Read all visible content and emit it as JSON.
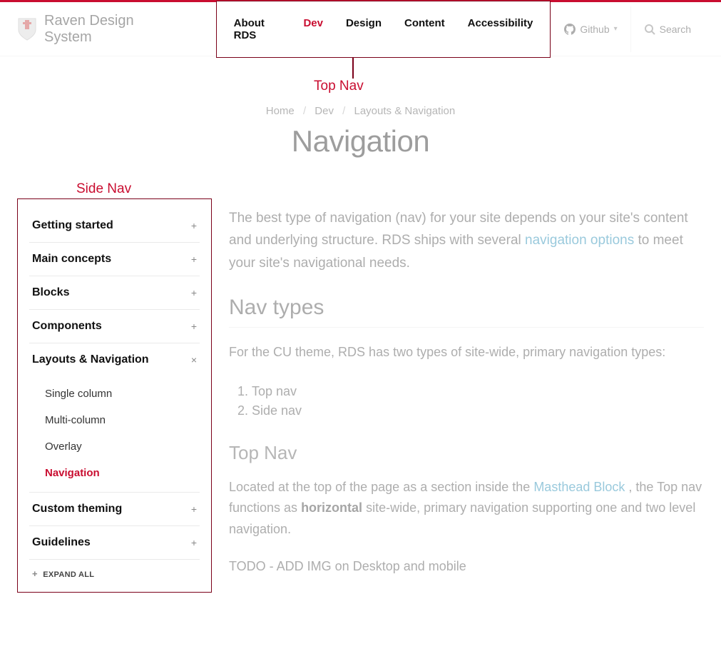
{
  "brand": {
    "name": "Raven Design System"
  },
  "topnav": {
    "items": [
      {
        "label": "About RDS",
        "active": false
      },
      {
        "label": "Dev",
        "active": true
      },
      {
        "label": "Design",
        "active": false
      },
      {
        "label": "Content",
        "active": false
      },
      {
        "label": "Accessibility",
        "active": false
      }
    ]
  },
  "header_right": {
    "github_label": "Github",
    "search_label": "Search"
  },
  "annotations": {
    "topnav_label": "Top Nav",
    "sidenav_label": "Side Nav"
  },
  "breadcrumb": {
    "items": [
      "Home",
      "Dev",
      "Layouts & Navigation"
    ]
  },
  "page_title": "Navigation",
  "sidenav": {
    "items": [
      {
        "label": "Getting started",
        "expanded": false
      },
      {
        "label": "Main concepts",
        "expanded": false
      },
      {
        "label": "Blocks",
        "expanded": false
      },
      {
        "label": "Components",
        "expanded": false
      },
      {
        "label": "Layouts & Navigation",
        "expanded": true,
        "children": [
          {
            "label": "Single column",
            "active": false
          },
          {
            "label": "Multi-column",
            "active": false
          },
          {
            "label": "Overlay",
            "active": false
          },
          {
            "label": "Navigation",
            "active": true
          }
        ]
      },
      {
        "label": "Custom theming",
        "expanded": false
      },
      {
        "label": "Guidelines",
        "expanded": false
      }
    ],
    "expand_all": "EXPAND ALL"
  },
  "content": {
    "intro_pre": "The best type of navigation (nav) for your site depends on your site's content and underlying structure. RDS ships with several ",
    "intro_link": "navigation options",
    "intro_post": " to meet your site's navigational needs.",
    "nav_types_heading": "Nav types",
    "nav_types_para": "For the CU theme, RDS has two types of site-wide, primary navigation types:",
    "nav_types_list": [
      "Top nav",
      "Side nav"
    ],
    "topnav_heading": "Top Nav",
    "topnav_p1_a": "Located at the top of the page as a section inside the ",
    "topnav_p1_link": "Masthead Block",
    "topnav_p1_b": " , the Top nav functions as ",
    "topnav_p1_bold": "horizontal",
    "topnav_p1_c": " site-wide, primary navigation supporting one and two level navigation.",
    "topnav_p2": "TODO - ADD IMG on Desktop and mobile"
  }
}
